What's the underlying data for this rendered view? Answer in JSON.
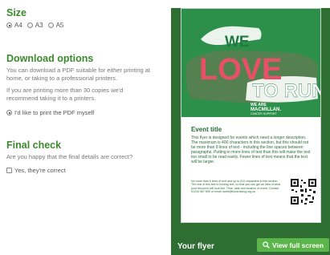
{
  "size": {
    "heading": "Size",
    "options": [
      {
        "label": "A4",
        "selected": true
      },
      {
        "label": "A3",
        "selected": false
      },
      {
        "label": "A5",
        "selected": false
      }
    ]
  },
  "download": {
    "heading": "Download options",
    "text1": "You can download a PDF suitable for either printing at home, or taking to a professional printers.",
    "text2": "If you are printing more than 30 copies we'd recommend taking it to a printers.",
    "option_label": "I'd like to print the PDF myself"
  },
  "final_check": {
    "heading": "Final check",
    "question": "Are you happy that the final details are correct?",
    "checkbox_label": "Yes, they're correct"
  },
  "preview": {
    "logo_we": "WE",
    "logo_love": "LOVE",
    "logo_to_run": "TO RUN",
    "sponsor_line1": "WE ARE",
    "sponsor_line2": "MACMILLAN.",
    "sponsor_line3": "CANCER SUPPORT",
    "event_title": "Event title",
    "event_text": "This flyer is designed for events which need a longer description. The maximum is 400 characters in this section, but this should not be more than 8 lines of text - including the line spaces between paragraphs. Putting in more lines of text than this will make the text too small to be read easily. Fewer lines of text means that the text will be larger.",
    "small_text": "No more than 6 lines of text and up to 210 characters in this section. The rest of this text is holding text, so that you can get an idea of what your resource will look like. Time, date and location of event. Contact 01234 567 890 or email name@fundraising.org.uk",
    "footer_label": "Your flyer",
    "view_button": "View full screen",
    "colors": {
      "panel": "#2e6e33",
      "banner": "#2c8f4a",
      "love": "#e8506a",
      "button": "#5bb54a",
      "heading": "#3b8a2c"
    }
  }
}
